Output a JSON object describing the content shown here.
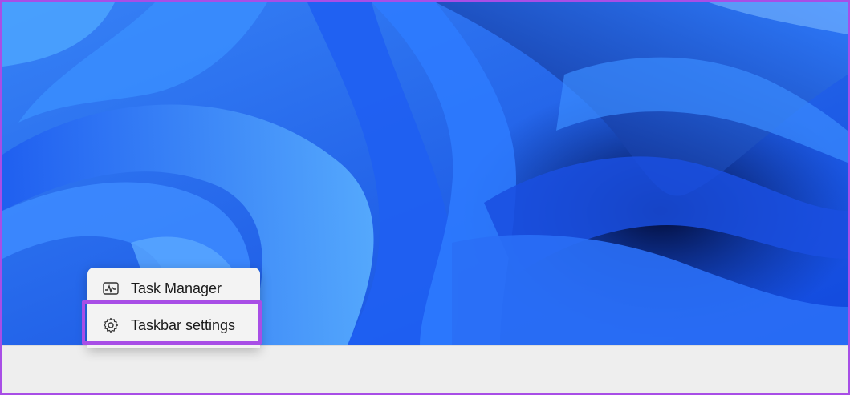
{
  "desktop": {
    "wallpaper": "windows-11-bloom-wallpaper",
    "accent_color": "#a84ee6"
  },
  "context_menu": {
    "items": [
      {
        "label": "Task Manager",
        "icon": "task-manager-icon"
      },
      {
        "label": "Taskbar settings",
        "icon": "gear-icon"
      }
    ],
    "highlighted_item": "Taskbar settings"
  }
}
